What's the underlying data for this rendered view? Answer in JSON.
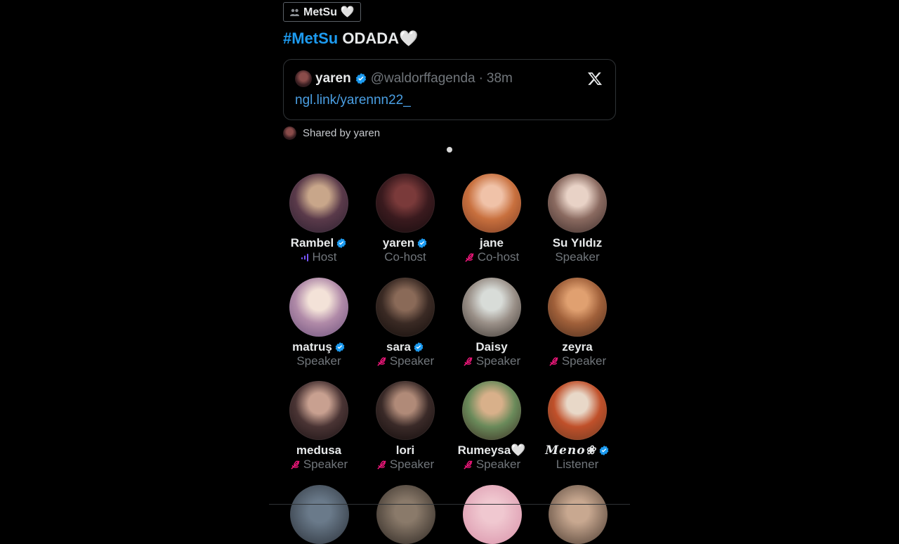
{
  "community": {
    "label": "MetSu 🤍",
    "icon": "people-icon"
  },
  "space": {
    "hashtag": "#MetSu",
    "title_rest": " ODADA🤍"
  },
  "tweet": {
    "name": "yaren",
    "handle": "@waldorffagenda",
    "separator": "·",
    "time": "38m",
    "link": "ngl.link/yarennn22_"
  },
  "shared_by": "Shared by yaren",
  "participants": [
    {
      "name": "Rambel",
      "verified": true,
      "role": "Host",
      "status": "speaking",
      "avatar_colors": [
        "#c8a68a",
        "#5a3a4a",
        "#2a1e2e"
      ]
    },
    {
      "name": "yaren",
      "verified": true,
      "role": "Co-host",
      "status": "none",
      "avatar_colors": [
        "#7a3a3a",
        "#3a1a1e",
        "#150c0e"
      ]
    },
    {
      "name": "jane",
      "verified": false,
      "role": "Co-host",
      "status": "muted",
      "avatar_colors": [
        "#f0c2a8",
        "#c8703e",
        "#7a3a22"
      ]
    },
    {
      "name": "Su Yıldız",
      "verified": false,
      "role": "Speaker",
      "status": "none",
      "avatar_colors": [
        "#e8d2c6",
        "#8a6a60",
        "#3a2a28"
      ]
    },
    {
      "name": "matruş",
      "verified": true,
      "role": "Speaker",
      "status": "none",
      "avatar_colors": [
        "#f3e2d8",
        "#b08aa8",
        "#6a4e7a"
      ]
    },
    {
      "name": "sara",
      "verified": true,
      "role": "Speaker",
      "status": "muted",
      "avatar_colors": [
        "#8a6a58",
        "#3a2a24",
        "#120c0a"
      ]
    },
    {
      "name": "Daisy",
      "verified": false,
      "role": "Speaker",
      "status": "muted",
      "avatar_colors": [
        "#d8dcd8",
        "#9a9088",
        "#3a3430"
      ]
    },
    {
      "name": "zeyra",
      "verified": false,
      "role": "Speaker",
      "status": "muted",
      "avatar_colors": [
        "#e0a070",
        "#a0603a",
        "#4a2a1a"
      ]
    },
    {
      "name": "medusa",
      "verified": false,
      "role": "Speaker",
      "status": "muted",
      "avatar_colors": [
        "#c8a090",
        "#4a3434",
        "#181012"
      ]
    },
    {
      "name": "lori",
      "verified": false,
      "role": "Speaker",
      "status": "muted",
      "avatar_colors": [
        "#b08a78",
        "#3a2a28",
        "#100a0a"
      ]
    },
    {
      "name": "Rumeysa🤍",
      "verified": false,
      "role": "Speaker",
      "status": "muted",
      "avatar_colors": [
        "#d8b08a",
        "#6a8a5a",
        "#3a2a20"
      ]
    },
    {
      "name": "𝑴𝒆𝒏𝒐❀",
      "verified": true,
      "role": "Listener",
      "status": "none",
      "avatar_colors": [
        "#e8d8c8",
        "#c0502a",
        "#6a3a22"
      ]
    }
  ],
  "partial_avatars": [
    {
      "name": "avatar-row4-1",
      "avatar_colors": [
        "#6a7a8a",
        "#2a3038"
      ]
    },
    {
      "name": "avatar-row4-2",
      "avatar_colors": [
        "#8a7a6a",
        "#2a2420"
      ]
    },
    {
      "name": "avatar-row4-3",
      "avatar_colors": [
        "#f0c8d0",
        "#d890a8"
      ]
    },
    {
      "name": "avatar-row4-4",
      "avatar_colors": [
        "#c8a890",
        "#4a3a30"
      ]
    }
  ],
  "colors": {
    "accent_blue": "#1d9bf0",
    "muted_mic_pink": "#f91880",
    "speaking_purple": "#7856ff",
    "secondary_text": "#71767b"
  }
}
